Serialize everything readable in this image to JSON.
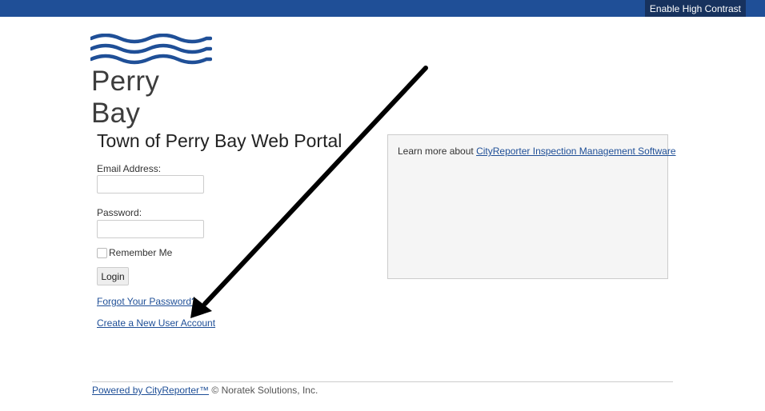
{
  "topbar": {
    "contrast_label": "Enable High Contrast"
  },
  "logo": {
    "text": "Perry Bay",
    "wave_color": "#1f4f97"
  },
  "login": {
    "title": "Town of Perry Bay Web Portal",
    "email_label": "Email Address:",
    "email_value": "",
    "password_label": "Password:",
    "password_value": "",
    "remember_label": "Remember Me",
    "remember_checked": false,
    "login_button": "Login",
    "forgot_link": "Forgot Your Password?",
    "create_link": "Create a New User Account"
  },
  "info": {
    "prefix": "Learn more about ",
    "link_text": "CityReporter Inspection Management Software"
  },
  "footer": {
    "powered_link": "Powered by CityReporter™",
    "copyright": " © Noratek Solutions, Inc."
  },
  "annotation": {
    "arrow_color": "#000000"
  },
  "colors": {
    "brand": "#1f4f97",
    "brand_dark": "#17325e",
    "link": "#1f4f97"
  }
}
